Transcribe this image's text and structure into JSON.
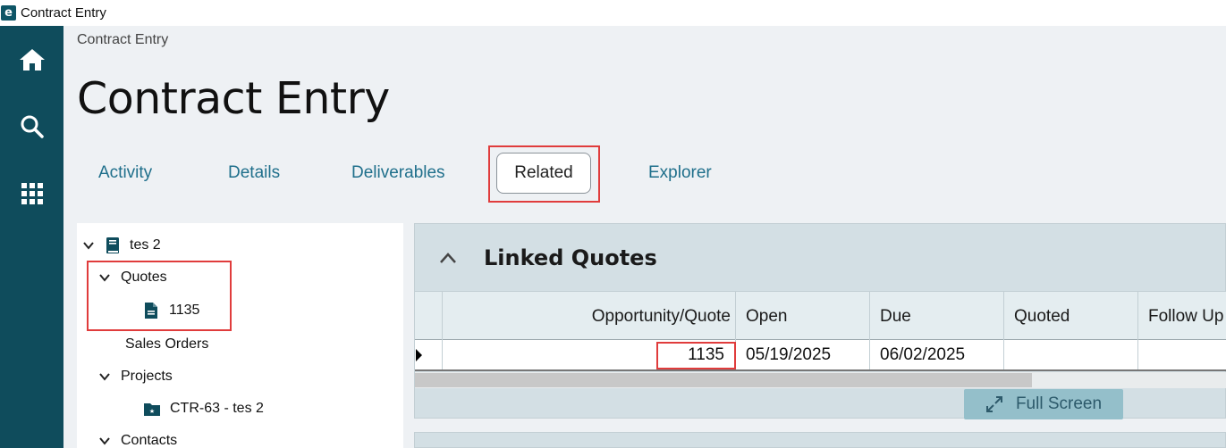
{
  "window": {
    "title": "Contract Entry",
    "logo_letter": "e"
  },
  "nav": {
    "icons": [
      "home-icon",
      "search-icon",
      "apps-grid-icon"
    ]
  },
  "breadcrumb": "Contract Entry",
  "page_title": "Contract Entry",
  "tabs": [
    {
      "label": "Activity"
    },
    {
      "label": "Details"
    },
    {
      "label": "Deliverables"
    },
    {
      "label": "Related",
      "selected": true
    },
    {
      "label": "Explorer"
    }
  ],
  "tree": {
    "root": "tes 2",
    "quotes": {
      "label": "Quotes",
      "items": [
        "1135"
      ]
    },
    "sales_orders": "Sales Orders",
    "projects": {
      "label": "Projects",
      "items": [
        "CTR-63 - tes 2"
      ]
    },
    "contacts": "Contacts"
  },
  "linked_quotes": {
    "title": "Linked Quotes",
    "columns": [
      "Opportunity/Quote",
      "Open",
      "Due",
      "Quoted",
      "Follow Up"
    ],
    "rows": [
      {
        "quote": "1135",
        "open": "05/19/2025",
        "due": "06/02/2025",
        "quoted": "",
        "follow_up": ""
      }
    ],
    "full_screen_label": "Full Screen"
  },
  "colors": {
    "nav": "#0f4c5c",
    "accent": "#1f6f8b",
    "highlight": "#e03c3c"
  }
}
